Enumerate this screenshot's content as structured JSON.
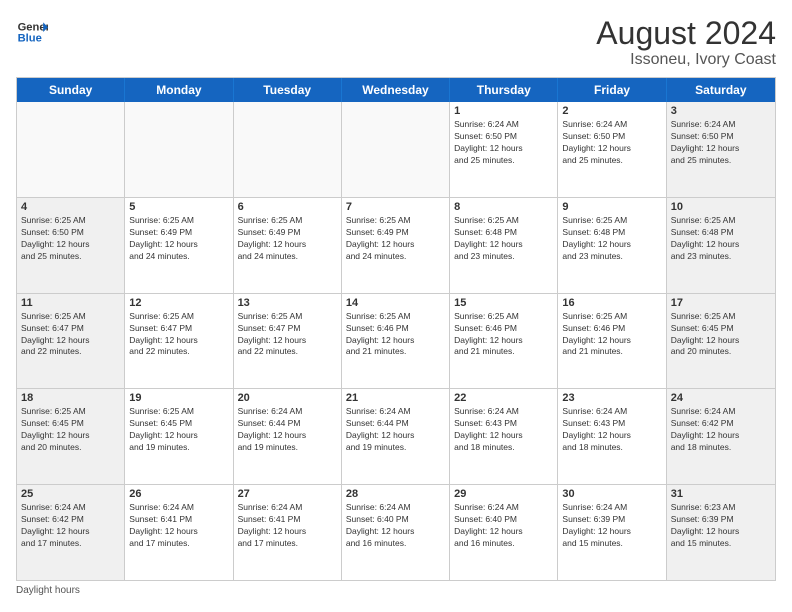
{
  "header": {
    "logo_line1": "General",
    "logo_line2": "Blue",
    "title": "August 2024",
    "subtitle": "Issoneu, Ivory Coast"
  },
  "days_of_week": [
    "Sunday",
    "Monday",
    "Tuesday",
    "Wednesday",
    "Thursday",
    "Friday",
    "Saturday"
  ],
  "weeks": [
    [
      {
        "day": "",
        "info": "",
        "empty": true
      },
      {
        "day": "",
        "info": "",
        "empty": true
      },
      {
        "day": "",
        "info": "",
        "empty": true
      },
      {
        "day": "",
        "info": "",
        "empty": true
      },
      {
        "day": "1",
        "info": "Sunrise: 6:24 AM\nSunset: 6:50 PM\nDaylight: 12 hours\nand 25 minutes.",
        "empty": false
      },
      {
        "day": "2",
        "info": "Sunrise: 6:24 AM\nSunset: 6:50 PM\nDaylight: 12 hours\nand 25 minutes.",
        "empty": false
      },
      {
        "day": "3",
        "info": "Sunrise: 6:24 AM\nSunset: 6:50 PM\nDaylight: 12 hours\nand 25 minutes.",
        "empty": false
      }
    ],
    [
      {
        "day": "4",
        "info": "Sunrise: 6:25 AM\nSunset: 6:50 PM\nDaylight: 12 hours\nand 25 minutes.",
        "empty": false
      },
      {
        "day": "5",
        "info": "Sunrise: 6:25 AM\nSunset: 6:49 PM\nDaylight: 12 hours\nand 24 minutes.",
        "empty": false
      },
      {
        "day": "6",
        "info": "Sunrise: 6:25 AM\nSunset: 6:49 PM\nDaylight: 12 hours\nand 24 minutes.",
        "empty": false
      },
      {
        "day": "7",
        "info": "Sunrise: 6:25 AM\nSunset: 6:49 PM\nDaylight: 12 hours\nand 24 minutes.",
        "empty": false
      },
      {
        "day": "8",
        "info": "Sunrise: 6:25 AM\nSunset: 6:48 PM\nDaylight: 12 hours\nand 23 minutes.",
        "empty": false
      },
      {
        "day": "9",
        "info": "Sunrise: 6:25 AM\nSunset: 6:48 PM\nDaylight: 12 hours\nand 23 minutes.",
        "empty": false
      },
      {
        "day": "10",
        "info": "Sunrise: 6:25 AM\nSunset: 6:48 PM\nDaylight: 12 hours\nand 23 minutes.",
        "empty": false
      }
    ],
    [
      {
        "day": "11",
        "info": "Sunrise: 6:25 AM\nSunset: 6:47 PM\nDaylight: 12 hours\nand 22 minutes.",
        "empty": false
      },
      {
        "day": "12",
        "info": "Sunrise: 6:25 AM\nSunset: 6:47 PM\nDaylight: 12 hours\nand 22 minutes.",
        "empty": false
      },
      {
        "day": "13",
        "info": "Sunrise: 6:25 AM\nSunset: 6:47 PM\nDaylight: 12 hours\nand 22 minutes.",
        "empty": false
      },
      {
        "day": "14",
        "info": "Sunrise: 6:25 AM\nSunset: 6:46 PM\nDaylight: 12 hours\nand 21 minutes.",
        "empty": false
      },
      {
        "day": "15",
        "info": "Sunrise: 6:25 AM\nSunset: 6:46 PM\nDaylight: 12 hours\nand 21 minutes.",
        "empty": false
      },
      {
        "day": "16",
        "info": "Sunrise: 6:25 AM\nSunset: 6:46 PM\nDaylight: 12 hours\nand 21 minutes.",
        "empty": false
      },
      {
        "day": "17",
        "info": "Sunrise: 6:25 AM\nSunset: 6:45 PM\nDaylight: 12 hours\nand 20 minutes.",
        "empty": false
      }
    ],
    [
      {
        "day": "18",
        "info": "Sunrise: 6:25 AM\nSunset: 6:45 PM\nDaylight: 12 hours\nand 20 minutes.",
        "empty": false
      },
      {
        "day": "19",
        "info": "Sunrise: 6:25 AM\nSunset: 6:45 PM\nDaylight: 12 hours\nand 19 minutes.",
        "empty": false
      },
      {
        "day": "20",
        "info": "Sunrise: 6:24 AM\nSunset: 6:44 PM\nDaylight: 12 hours\nand 19 minutes.",
        "empty": false
      },
      {
        "day": "21",
        "info": "Sunrise: 6:24 AM\nSunset: 6:44 PM\nDaylight: 12 hours\nand 19 minutes.",
        "empty": false
      },
      {
        "day": "22",
        "info": "Sunrise: 6:24 AM\nSunset: 6:43 PM\nDaylight: 12 hours\nand 18 minutes.",
        "empty": false
      },
      {
        "day": "23",
        "info": "Sunrise: 6:24 AM\nSunset: 6:43 PM\nDaylight: 12 hours\nand 18 minutes.",
        "empty": false
      },
      {
        "day": "24",
        "info": "Sunrise: 6:24 AM\nSunset: 6:42 PM\nDaylight: 12 hours\nand 18 minutes.",
        "empty": false
      }
    ],
    [
      {
        "day": "25",
        "info": "Sunrise: 6:24 AM\nSunset: 6:42 PM\nDaylight: 12 hours\nand 17 minutes.",
        "empty": false
      },
      {
        "day": "26",
        "info": "Sunrise: 6:24 AM\nSunset: 6:41 PM\nDaylight: 12 hours\nand 17 minutes.",
        "empty": false
      },
      {
        "day": "27",
        "info": "Sunrise: 6:24 AM\nSunset: 6:41 PM\nDaylight: 12 hours\nand 17 minutes.",
        "empty": false
      },
      {
        "day": "28",
        "info": "Sunrise: 6:24 AM\nSunset: 6:40 PM\nDaylight: 12 hours\nand 16 minutes.",
        "empty": false
      },
      {
        "day": "29",
        "info": "Sunrise: 6:24 AM\nSunset: 6:40 PM\nDaylight: 12 hours\nand 16 minutes.",
        "empty": false
      },
      {
        "day": "30",
        "info": "Sunrise: 6:24 AM\nSunset: 6:39 PM\nDaylight: 12 hours\nand 15 minutes.",
        "empty": false
      },
      {
        "day": "31",
        "info": "Sunrise: 6:23 AM\nSunset: 6:39 PM\nDaylight: 12 hours\nand 15 minutes.",
        "empty": false
      }
    ]
  ],
  "footer": {
    "daylight_label": "Daylight hours"
  }
}
